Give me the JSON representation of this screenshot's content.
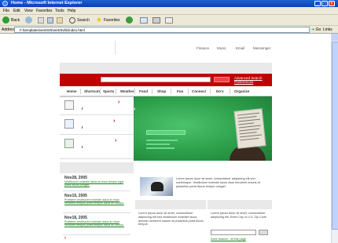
{
  "window": {
    "title": "Home - Microsoft Internet Explorer"
  },
  "menu": [
    "File",
    "Edit",
    "View",
    "Favorites",
    "Tools",
    "Help"
  ],
  "toolbar": {
    "back": "Back",
    "search": "Search",
    "favorites": "Favorites"
  },
  "address": {
    "label": "Address",
    "url": "F:\\templates\\vertr0r5\\vertr5vlib\\index.html",
    "go": "Go",
    "links": "Links"
  },
  "topnav": [
    "Finance",
    "Music",
    "Email",
    "Messenger"
  ],
  "search": {
    "advanced": "Advanced Search\nPreferences"
  },
  "nav": [
    "Home",
    "Shortcuts",
    "Sports",
    "Weather",
    "Food",
    "Shop",
    "Fun",
    "Connect",
    "Do's",
    "Organize"
  ],
  "news": {
    "items": [
      {
        "date": "Nov28, 2005",
        "text": "Vestibulum molestie lacus eu risus tempor eget porta fiscus cologet."
      },
      {
        "date": "Nov19, 2005",
        "text": "Praesent vestibulum molestie lacus eu risus hendrerit tempus porta tempus lacus eu cursus."
      },
      {
        "date": "Nov18, 2005",
        "text": "Praesent vestibulum molestie lacus eu risus hendrerit tempus porta tempus lacus eu cursus."
      }
    ]
  },
  "feature": {
    "text": "Lorem ipsum dolor sit amet, consectetuer adipiscing elit sed scelerisque. Vestibulum molestie lacus risus hendrerit mauris at phasellus porta fiscus tempor cologet."
  },
  "bottom_left": {
    "text": "Lorem ipsum dolor sit amet, consectetuer adipiscing elit sed vestibulum molestie lacus aenean hendrerit mauris at phasellus porta fiscus tempor."
  },
  "bottom_right": {
    "text": "Lorem ipsum dolor sit amet, consectetuer adipiscing elit. Enter City or U.S. Zip Code",
    "link": "Zone finance - at this page"
  }
}
